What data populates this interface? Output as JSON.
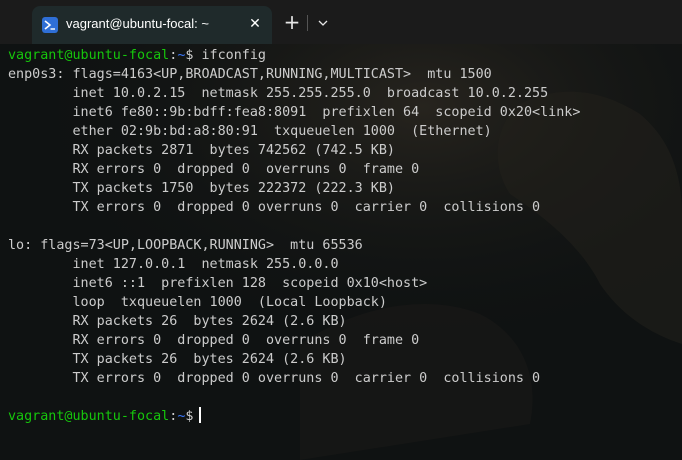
{
  "colors": {
    "prompt_user_host": "#16c60c",
    "prompt_path": "#3b78ff",
    "output_text": "#cccccc",
    "background": "#0f1212",
    "tab_icon": "#2f6fd6"
  },
  "titlebar": {
    "tab": {
      "icon": "powershell-terminal-icon",
      "title": "vagrant@ubuntu-focal: ~",
      "close_label": "✕"
    },
    "new_tab_label": "+",
    "dropdown_icon": "chevron-down-icon"
  },
  "terminal": {
    "prompt": {
      "user_host": "vagrant@ubuntu-focal",
      "separator": ":",
      "path": "~",
      "symbol": "$"
    },
    "command": "ifconfig",
    "output": [
      "enp0s3: flags=4163<UP,BROADCAST,RUNNING,MULTICAST>  mtu 1500",
      "        inet 10.0.2.15  netmask 255.255.255.0  broadcast 10.0.2.255",
      "        inet6 fe80::9b:bdff:fea8:8091  prefixlen 64  scopeid 0x20<link>",
      "        ether 02:9b:bd:a8:80:91  txqueuelen 1000  (Ethernet)",
      "        RX packets 2871  bytes 742562 (742.5 KB)",
      "        RX errors 0  dropped 0  overruns 0  frame 0",
      "        TX packets 1750  bytes 222372 (222.3 KB)",
      "        TX errors 0  dropped 0 overruns 0  carrier 0  collisions 0",
      "",
      "lo: flags=73<UP,LOOPBACK,RUNNING>  mtu 65536",
      "        inet 127.0.0.1  netmask 255.0.0.0",
      "        inet6 ::1  prefixlen 128  scopeid 0x10<host>",
      "        loop  txqueuelen 1000  (Local Loopback)",
      "        RX packets 26  bytes 2624 (2.6 KB)",
      "        RX errors 0  dropped 0  overruns 0  frame 0",
      "        TX packets 26  bytes 2624 (2.6 KB)",
      "        TX errors 0  dropped 0 overruns 0  carrier 0  collisions 0",
      ""
    ]
  }
}
